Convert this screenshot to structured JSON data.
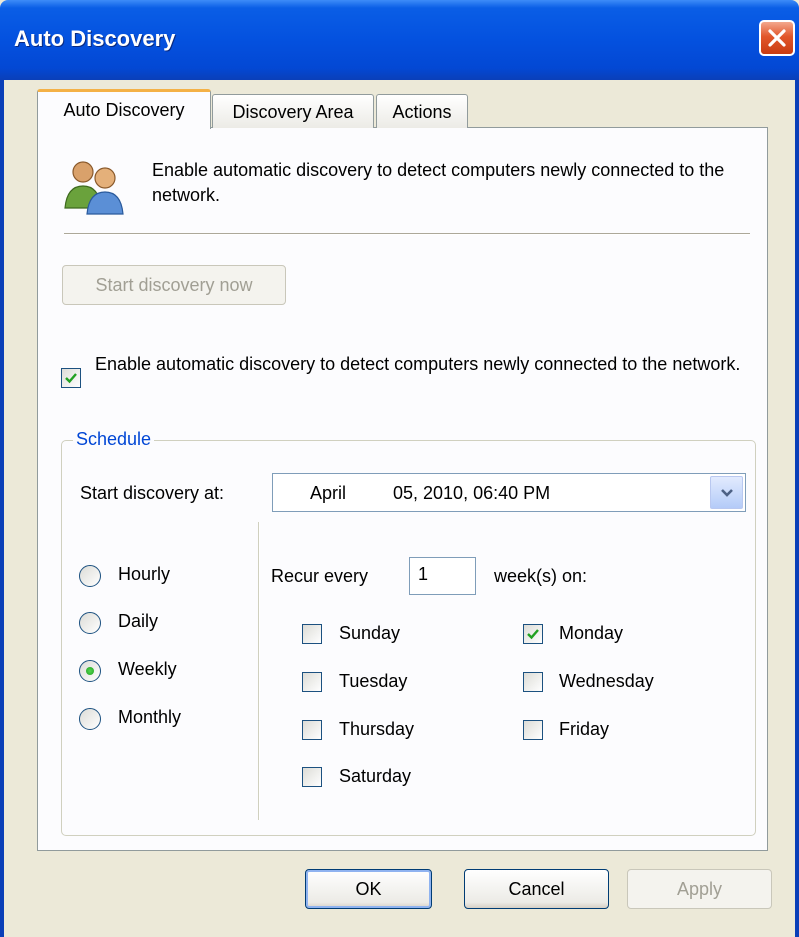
{
  "window": {
    "title": "Auto Discovery"
  },
  "tabs": [
    {
      "label": "Auto Discovery",
      "active": true
    },
    {
      "label": "Discovery Area",
      "active": false
    },
    {
      "label": "Actions",
      "active": false
    }
  ],
  "intro": {
    "icon": "users-icon",
    "text": "Enable automatic discovery to detect computers newly connected to the network."
  },
  "start_now_button": {
    "label": "Start discovery now",
    "enabled": false
  },
  "enable_checkbox": {
    "label": "Enable automatic discovery to detect computers newly connected to the network.",
    "checked": true
  },
  "schedule": {
    "legend": "Schedule",
    "start_label": "Start discovery at:",
    "start_month": "April",
    "start_rest": "05, 2010, 06:40 PM",
    "frequencies": [
      {
        "label": "Hourly",
        "selected": false
      },
      {
        "label": "Daily",
        "selected": false
      },
      {
        "label": "Weekly",
        "selected": true
      },
      {
        "label": "Monthly",
        "selected": false
      }
    ],
    "recur_prefix": "Recur every",
    "recur_value": "1",
    "recur_suffix": "week(s) on:",
    "days": [
      {
        "label": "Sunday",
        "checked": false
      },
      {
        "label": "Monday",
        "checked": true
      },
      {
        "label": "Tuesday",
        "checked": false
      },
      {
        "label": "Wednesday",
        "checked": false
      },
      {
        "label": "Thursday",
        "checked": false
      },
      {
        "label": "Friday",
        "checked": false
      },
      {
        "label": "Saturday",
        "checked": false
      }
    ]
  },
  "footer": {
    "ok": "OK",
    "cancel": "Cancel",
    "apply": "Apply"
  },
  "colors": {
    "titlebar": "#0451df",
    "legend_text": "#0046d5",
    "active_tab_accent": "#f4b146",
    "radio_dot": "#21a121"
  }
}
